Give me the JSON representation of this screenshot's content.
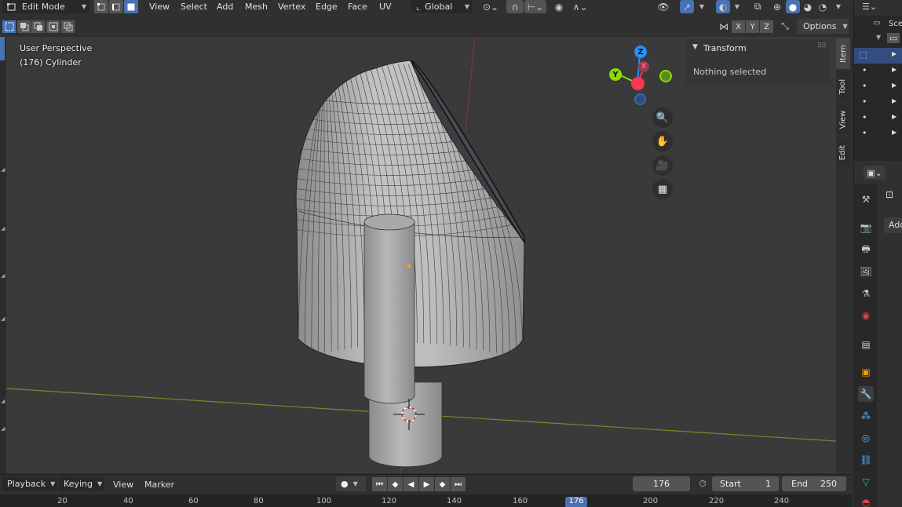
{
  "header": {
    "mode": "Edit Mode",
    "menus": [
      "View",
      "Select",
      "Add",
      "Mesh",
      "Vertex",
      "Edge",
      "Face",
      "UV"
    ],
    "orientation": "Global"
  },
  "toolbar": {
    "axes": [
      "X",
      "Y",
      "Z"
    ],
    "options": "Options"
  },
  "viewport": {
    "view_name": "User Perspective",
    "object_name": "(176) Cylinder",
    "gizmo": {
      "z": "Z",
      "y": "Y",
      "x": "X"
    }
  },
  "npanel": {
    "section": "Transform",
    "message": "Nothing selected",
    "tabs": [
      "Item",
      "Tool",
      "View",
      "Edit"
    ]
  },
  "outliner": {
    "header_label": "Sce"
  },
  "properties": {
    "add_button": "Add"
  },
  "timeline": {
    "menus": {
      "playback": "Playback",
      "keying": "Keying",
      "view": "View",
      "marker": "Marker"
    },
    "current_frame": "176",
    "start_label": "Start",
    "start_value": "1",
    "end_label": "End",
    "end_value": "250",
    "ruler_ticks": [
      "20",
      "40",
      "60",
      "80",
      "100",
      "120",
      "140",
      "160",
      "176",
      "200",
      "220",
      "240"
    ]
  },
  "colors": {
    "accent": "#4772b3",
    "x_axis": "#ff3352",
    "y_axis": "#8bdc00",
    "z_axis": "#2890ff"
  }
}
